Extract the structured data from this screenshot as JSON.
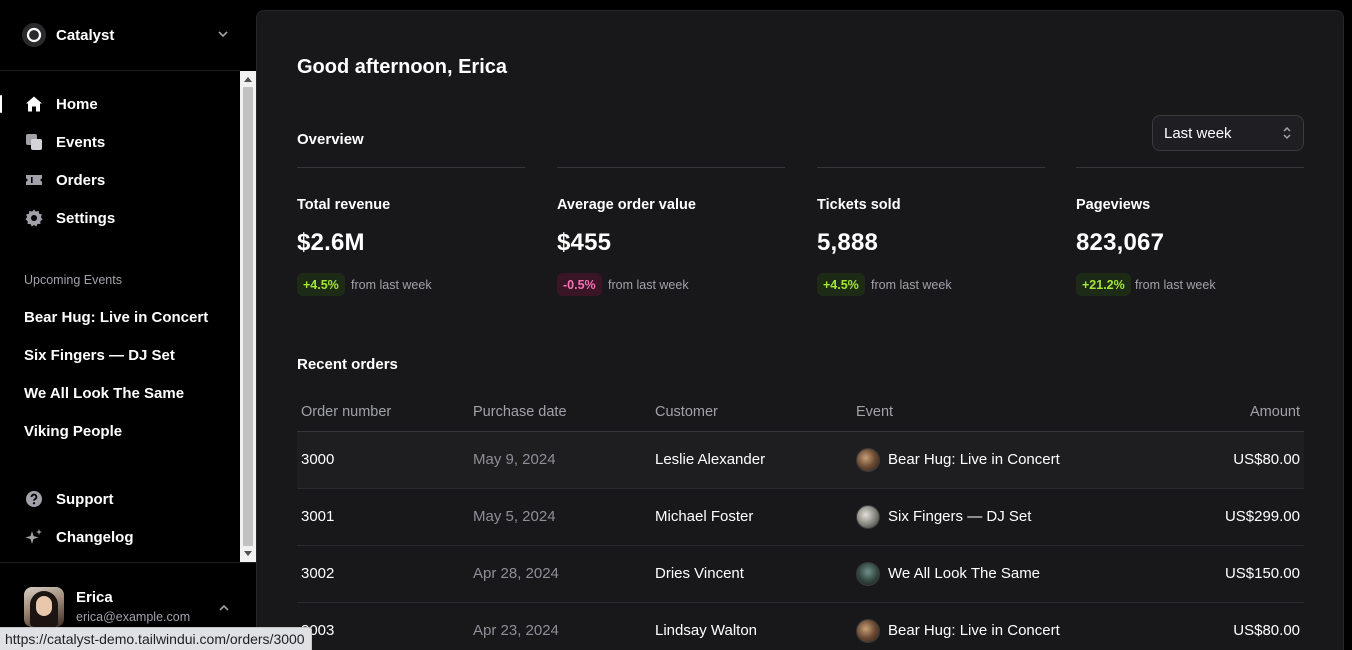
{
  "team": {
    "name": "Catalyst"
  },
  "nav": [
    {
      "label": "Home",
      "icon": "home-icon",
      "active": true
    },
    {
      "label": "Events",
      "icon": "events-icon"
    },
    {
      "label": "Orders",
      "icon": "ticket-icon"
    },
    {
      "label": "Settings",
      "icon": "gear-icon"
    }
  ],
  "upcoming": {
    "label": "Upcoming Events",
    "items": [
      "Bear Hug: Live in Concert",
      "Six Fingers — DJ Set",
      "We All Look The Same",
      "Viking People"
    ]
  },
  "bottom_nav": [
    {
      "label": "Support",
      "icon": "question-icon"
    },
    {
      "label": "Changelog",
      "icon": "sparkles-icon"
    }
  ],
  "profile": {
    "name": "Erica",
    "email": "erica@example.com"
  },
  "status_url": "https://catalyst-demo.tailwindui.com/orders/3000",
  "main": {
    "greeting": "Good afternoon, Erica",
    "overview": "Overview",
    "period": "Last week",
    "stats": [
      {
        "label": "Total revenue",
        "value": "$2.6M",
        "change": "+4.5%",
        "trend": "pos",
        "sub": "from last week"
      },
      {
        "label": "Average order value",
        "value": "$455",
        "change": "-0.5%",
        "trend": "neg",
        "sub": "from last week"
      },
      {
        "label": "Tickets sold",
        "value": "5,888",
        "change": "+4.5%",
        "trend": "pos",
        "sub": "from last week"
      },
      {
        "label": "Pageviews",
        "value": "823,067",
        "change": "+21.2%",
        "trend": "pos",
        "sub": "from last week"
      }
    ],
    "recent_title": "Recent orders",
    "columns": [
      "Order number",
      "Purchase date",
      "Customer",
      "Event",
      "Amount"
    ],
    "orders": [
      {
        "id": "3000",
        "date": "May 9, 2024",
        "customer": "Leslie Alexander",
        "event": "Bear Hug: Live in Concert",
        "amount": "US$80.00"
      },
      {
        "id": "3001",
        "date": "May 5, 2024",
        "customer": "Michael Foster",
        "event": "Six Fingers — DJ Set",
        "amount": "US$299.00"
      },
      {
        "id": "3002",
        "date": "Apr 28, 2024",
        "customer": "Dries Vincent",
        "event": "We All Look The Same",
        "amount": "US$150.00"
      },
      {
        "id": "3003",
        "date": "Apr 23, 2024",
        "customer": "Lindsay Walton",
        "event": "Bear Hug: Live in Concert",
        "amount": "US$80.00"
      }
    ]
  }
}
